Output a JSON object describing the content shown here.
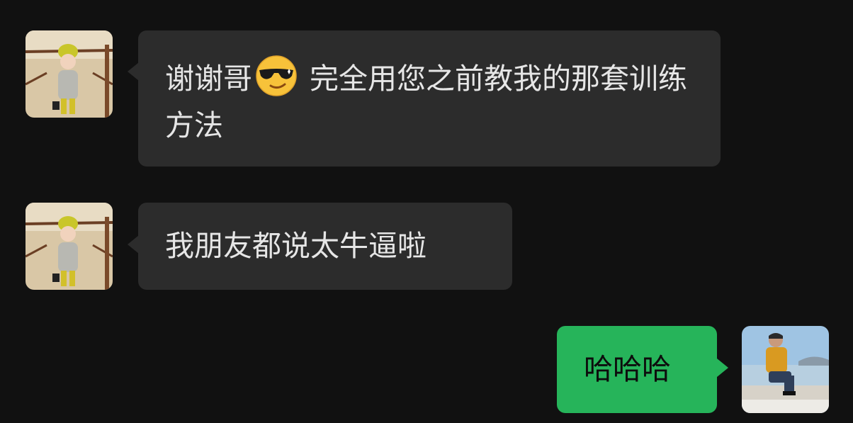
{
  "chat": {
    "messages": [
      {
        "sender": "contact",
        "text_before_emoji": "谢谢哥",
        "emoji": "smiling-face-with-sunglasses-icon",
        "text_after_emoji": " 完全用您之前教我的那套训练方法"
      },
      {
        "sender": "contact",
        "text": "我朋友都说太牛逼啦"
      },
      {
        "sender": "me",
        "text": "哈哈哈"
      }
    ]
  },
  "colors": {
    "background": "#111111",
    "incoming_bubble": "#2c2c2c",
    "outgoing_bubble": "#26b45a",
    "incoming_text": "#e6e6e6",
    "outgoing_text": "#0d0d0d"
  }
}
